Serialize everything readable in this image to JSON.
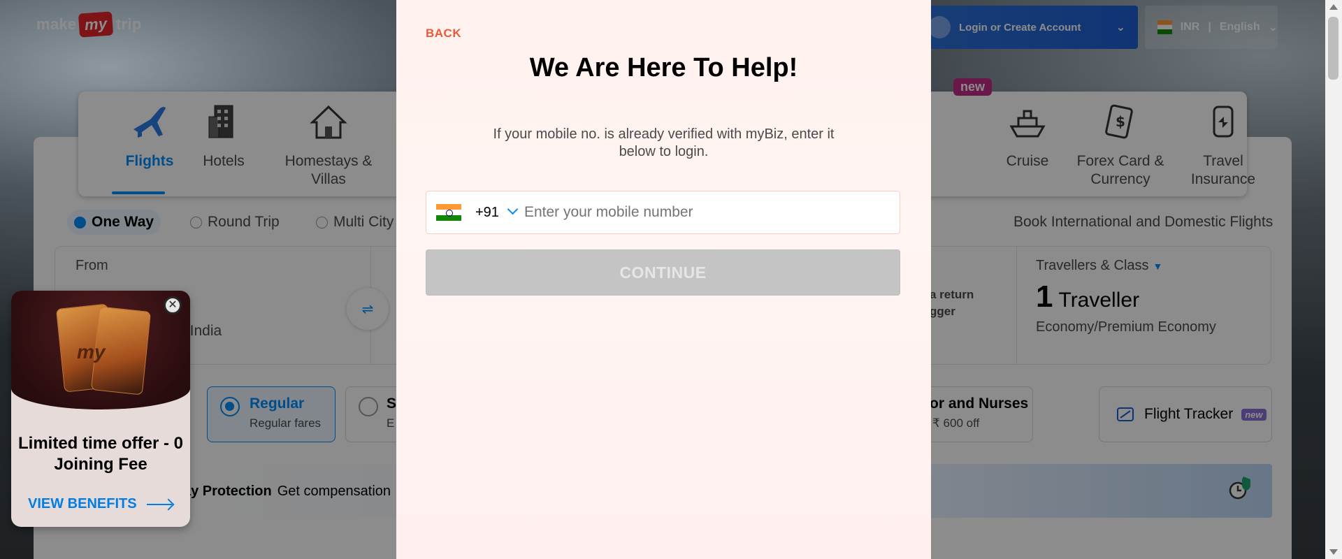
{
  "header": {
    "logo_left": "make",
    "logo_mid": "my",
    "logo_right": "trip",
    "login_label": "Login or Create Account",
    "currency": "INR",
    "language": "English"
  },
  "nav": {
    "items": [
      {
        "label": "Flights",
        "icon": "airplane-icon",
        "active": true
      },
      {
        "label": "Hotels",
        "icon": "hotel-building-icon"
      },
      {
        "label": "Homestays & Villas",
        "icon": "house-icon"
      },
      {
        "label": "Cruise",
        "icon": "ship-icon",
        "tag": "new"
      },
      {
        "label": "Forex Card & Currency",
        "icon": "currency-card-icon"
      },
      {
        "label": "Travel Insurance",
        "icon": "insurance-shield-icon"
      }
    ]
  },
  "trip_types": {
    "one_way": "One Way",
    "round_trip": "Round Trip",
    "multi_city": "Multi City",
    "selected": "One Way"
  },
  "book_intl": "Book International and Domestic Flights",
  "search": {
    "from_label": "From",
    "from_sub": "t India",
    "book_return_line1": "a return",
    "book_return_line2": "gger",
    "travellers_label": "Travellers & Class",
    "travellers_count": "1",
    "travellers_unit": "Traveller",
    "travellers_class": "Economy/Premium Economy"
  },
  "fares": {
    "regular_title": "Regular",
    "regular_sub": "Regular fares",
    "student_title": "S",
    "student_sub": "E",
    "nurses_title": "or and Nurses",
    "nurses_sub": "₹ 600 off"
  },
  "tracker": {
    "label": "Flight Tracker",
    "tag": "new"
  },
  "protection": {
    "bold": "ay Protection",
    "text": "Get compensation"
  },
  "promo": {
    "card_text": "my",
    "title": "Limited time offer - 0 Joining Fee",
    "link": "VIEW BENEFITS"
  },
  "modal": {
    "back": "BACK",
    "title": "We Are Here To Help!",
    "subtitle": "If your mobile no. is already verified with myBiz, enter it below to login.",
    "country_code": "+91",
    "phone_placeholder": "Enter your mobile number",
    "phone_value": "",
    "continue_label": "CONTINUE"
  },
  "colors": {
    "accent": "#008cff",
    "back_link": "#eb5b3a",
    "continue_disabled": "#c4c4c4"
  }
}
